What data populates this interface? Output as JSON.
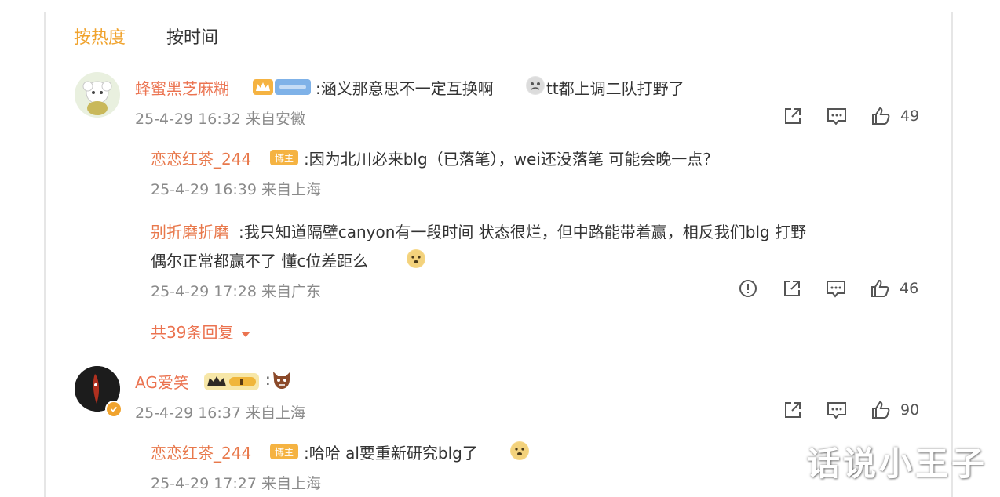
{
  "tabs": [
    {
      "label": "按热度",
      "active": true
    },
    {
      "label": "按时间",
      "active": false
    }
  ],
  "comments": [
    {
      "user": "蜂蜜黑芝麻糊",
      "text": ":涵义那意思不一定互换啊",
      "text_after_emoji": "tt都上调二队打野了",
      "meta": "25-4-29 16:32 来自安徽",
      "likes": "49",
      "replies": [
        {
          "user": "恋恋红茶_244",
          "badge": "博主",
          "text": ":因为北川必来blg（已落笔），wei还没落笔 可能会晚一点?",
          "meta": "25-4-29 16:39 来自上海"
        },
        {
          "user": "别折磨折磨",
          "text": ":我只知道隔壁canyon有一段时间 状态很烂，但中路能带着赢，相反我们blg 打野",
          "text_line2": "偶尔正常都赢不了 懂c位差距么",
          "meta": "25-4-29 17:28 来自广东",
          "likes": "46"
        }
      ],
      "more_replies": "共39条回复"
    },
    {
      "user": "AG爱笑",
      "text": ":",
      "meta": "25-4-29 16:37 来自上海",
      "likes": "90",
      "replies": [
        {
          "user": "恋恋红茶_244",
          "badge": "博主",
          "text": ":哈哈 al要重新研究blg了",
          "meta": "25-4-29 17:27 来自上海"
        }
      ]
    }
  ],
  "watermark": "话说小王子",
  "colors": {
    "accent": "#f0a32e",
    "nickname": "#eb7350",
    "meta": "#8a8a8a"
  },
  "icons": [
    "share-icon",
    "comment-icon",
    "like-icon",
    "report-icon",
    "caret-down-icon",
    "verified-icon"
  ]
}
